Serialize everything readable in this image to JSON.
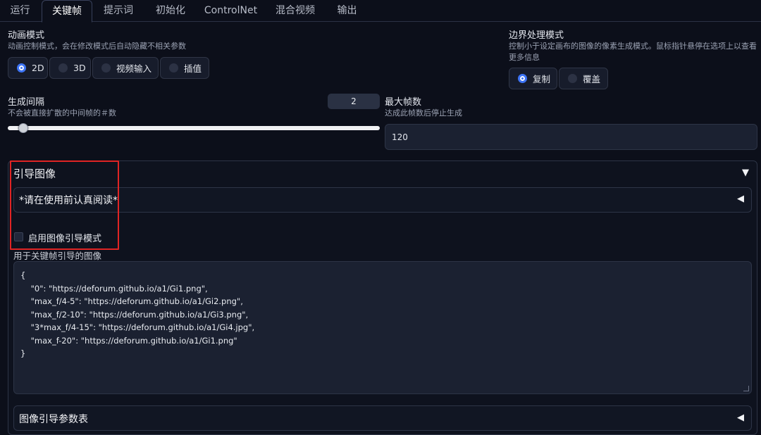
{
  "tabs": [
    {
      "label": "运行",
      "active": false
    },
    {
      "label": "关键帧",
      "active": true
    },
    {
      "label": "提示词",
      "active": false
    },
    {
      "label": "初始化",
      "active": false
    },
    {
      "label": "ControlNet",
      "active": false
    },
    {
      "label": "混合视频",
      "active": false
    },
    {
      "label": "输出",
      "active": false
    }
  ],
  "animation_mode": {
    "label": "动画模式",
    "description": "动画控制模式，会在修改模式后自动隐藏不相关参数",
    "options": [
      "2D",
      "3D",
      "视频输入",
      "插值"
    ],
    "selected": "2D"
  },
  "border_mode": {
    "label": "边界处理模式",
    "description_line1": "控制小于设定画布的图像的像素生成模式。鼠标指针悬停在选项上以查看",
    "description_line2": "更多信息",
    "options": [
      "复制",
      "覆盖"
    ],
    "selected": "复制"
  },
  "cadence": {
    "label": "生成间隔",
    "description": "不会被直接扩散的中间帧的＃数",
    "value": "2",
    "slider_fraction": 0.02
  },
  "max_frames": {
    "label": "最大帧数",
    "description": "达成此帧数后停止生成",
    "value": "120"
  },
  "guided_images": {
    "title": "引导图像",
    "collapse_icon": "triangle-down",
    "notice_title": "*请在使用前认真阅读*",
    "enable_label": "启用图像引导模式",
    "enabled": false,
    "images_label": "用于关键帧引导的图像",
    "images_json": "{\n    \"0\": \"https://deforum.github.io/a1/Gi1.png\",\n    \"max_f/4-5\": \"https://deforum.github.io/a1/Gi2.png\",\n    \"max_f/2-10\": \"https://deforum.github.io/a1/Gi3.png\",\n    \"3*max_f/4-15\": \"https://deforum.github.io/a1/Gi4.jpg\",\n    \"max_f-20\": \"https://deforum.github.io/a1/Gi1.png\"\n}",
    "schedule_title": "图像引导参数表"
  },
  "colors": {
    "accent": "#3d74f5",
    "highlight": "#e02424",
    "background": "#0c0f1a"
  }
}
